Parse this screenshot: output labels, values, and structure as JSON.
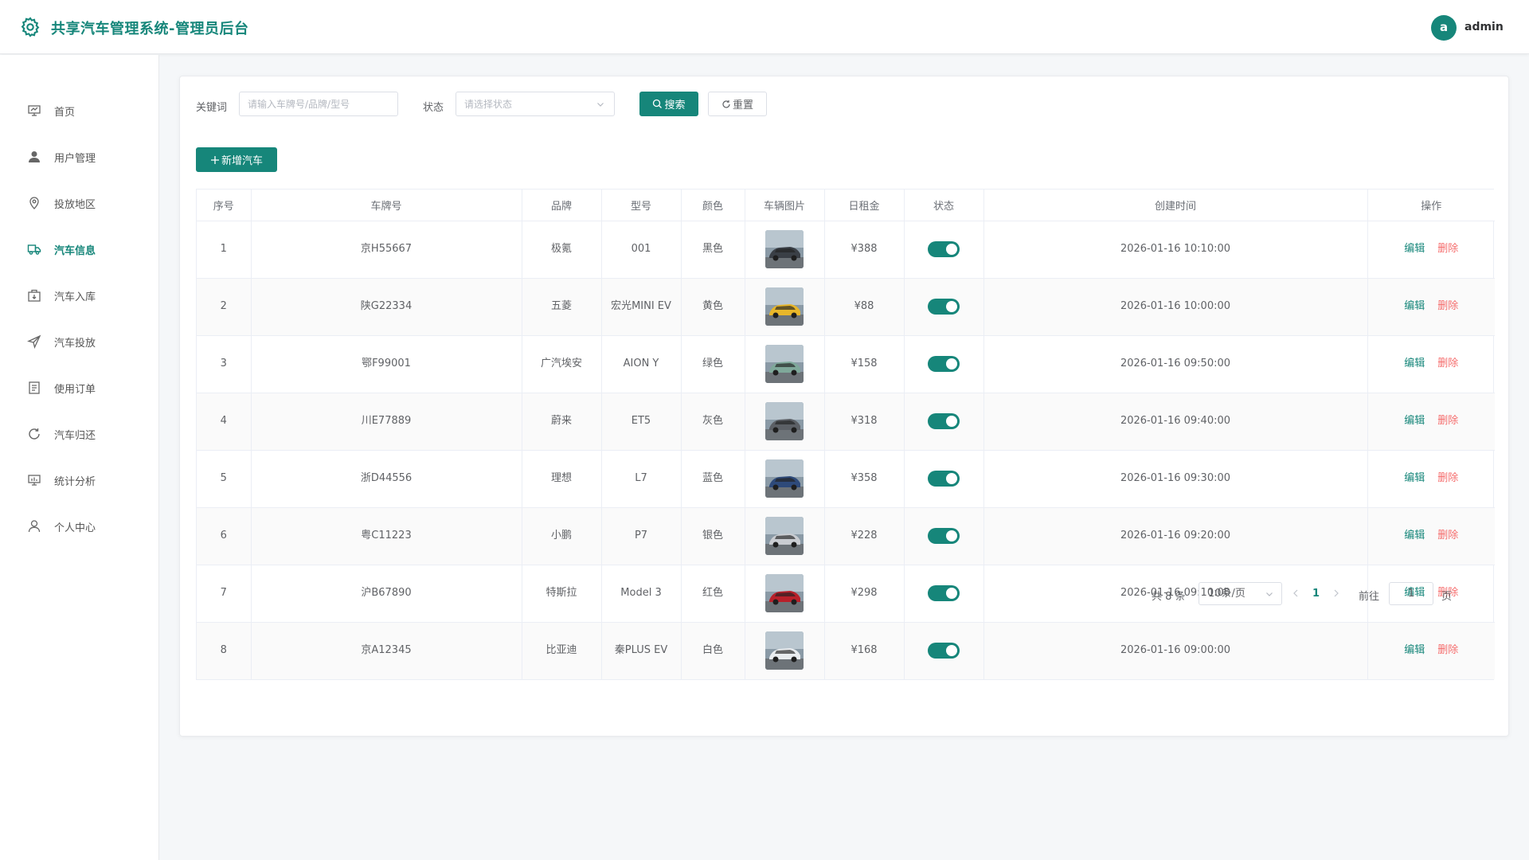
{
  "header": {
    "title": "共享汽车管理系统-管理员后台",
    "avatar_letter": "a",
    "username": "admin"
  },
  "sidebar": {
    "items": [
      {
        "label": "首页",
        "icon": "dashboard-icon",
        "active": false
      },
      {
        "label": "用户管理",
        "icon": "user-icon",
        "active": false
      },
      {
        "label": "投放地区",
        "icon": "location-icon",
        "active": false
      },
      {
        "label": "汽车信息",
        "icon": "truck-icon",
        "active": true
      },
      {
        "label": "汽车入库",
        "icon": "warehouse-icon",
        "active": false
      },
      {
        "label": "汽车投放",
        "icon": "send-icon",
        "active": false
      },
      {
        "label": "使用订单",
        "icon": "document-icon",
        "active": false
      },
      {
        "label": "汽车归还",
        "icon": "refresh-icon",
        "active": false
      },
      {
        "label": "统计分析",
        "icon": "chart-icon",
        "active": false
      },
      {
        "label": "个人中心",
        "icon": "person-icon",
        "active": false
      }
    ]
  },
  "search": {
    "keyword_label": "关键词",
    "keyword_placeholder": "请输入车牌号/品牌/型号",
    "status_label": "状态",
    "status_placeholder": "请选择状态",
    "search_button": "搜索",
    "reset_button": "重置",
    "add_button": "新增汽车"
  },
  "table": {
    "columns": [
      "序号",
      "车牌号",
      "品牌",
      "型号",
      "颜色",
      "车辆图片",
      "日租金",
      "状态",
      "创建时间",
      "操作"
    ],
    "edit_label": "编辑",
    "delete_label": "删除",
    "rows": [
      {
        "no": "1",
        "plate": "京H55667",
        "brand": "极氪",
        "model": "001",
        "color": "黑色",
        "rent": "¥388",
        "created": "2026-01-16 10:10:00",
        "enabled": true,
        "car_tone": "#3a3f46"
      },
      {
        "no": "2",
        "plate": "陕G22334",
        "brand": "五菱",
        "model": "宏光MINI EV",
        "color": "黄色",
        "rent": "¥88",
        "created": "2026-01-16 10:00:00",
        "enabled": true,
        "car_tone": "#e8b629"
      },
      {
        "no": "3",
        "plate": "鄂F99001",
        "brand": "广汽埃安",
        "model": "AION Y",
        "color": "绿色",
        "rent": "¥158",
        "created": "2026-01-16 09:50:00",
        "enabled": true,
        "car_tone": "#7fa89a"
      },
      {
        "no": "4",
        "plate": "川E77889",
        "brand": "蔚来",
        "model": "ET5",
        "color": "灰色",
        "rent": "¥318",
        "created": "2026-01-16 09:40:00",
        "enabled": true,
        "car_tone": "#5c6066"
      },
      {
        "no": "5",
        "plate": "浙D44556",
        "brand": "理想",
        "model": "L7",
        "color": "蓝色",
        "rent": "¥358",
        "created": "2026-01-16 09:30:00",
        "enabled": true,
        "car_tone": "#2e4a7a"
      },
      {
        "no": "6",
        "plate": "粤C11223",
        "brand": "小鹏",
        "model": "P7",
        "color": "银色",
        "rent": "¥228",
        "created": "2026-01-16 09:20:00",
        "enabled": true,
        "car_tone": "#c9ccd1"
      },
      {
        "no": "7",
        "plate": "沪B67890",
        "brand": "特斯拉",
        "model": "Model 3",
        "color": "红色",
        "rent": "¥298",
        "created": "2026-01-16 09:10:00",
        "enabled": true,
        "car_tone": "#b8202a"
      },
      {
        "no": "8",
        "plate": "京A12345",
        "brand": "比亚迪",
        "model": "秦PLUS EV",
        "color": "白色",
        "rent": "¥168",
        "created": "2026-01-16 09:00:00",
        "enabled": true,
        "car_tone": "#e9ecef"
      }
    ]
  },
  "pagination": {
    "total_text": "共 8 条",
    "page_size": "10条/页",
    "current_page": "1",
    "goto_label": "前往",
    "goto_value": "1",
    "page_suffix": "页"
  },
  "colors": {
    "primary": "#16867a",
    "danger": "#f56c6c"
  }
}
